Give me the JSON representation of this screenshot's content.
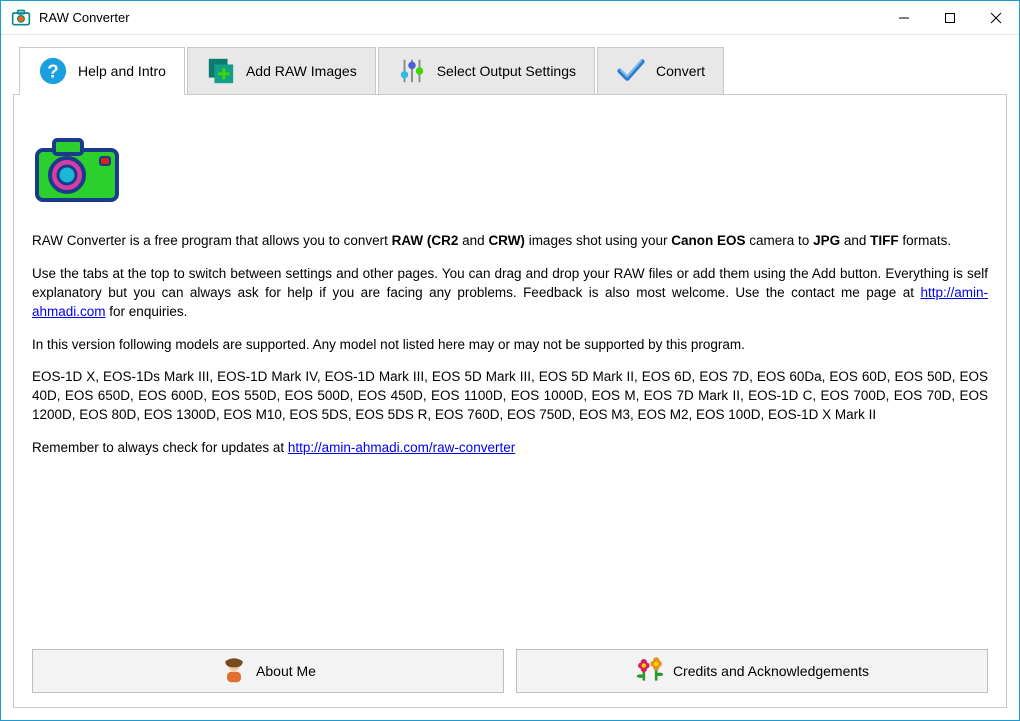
{
  "window": {
    "title": "RAW Converter"
  },
  "tabs": [
    {
      "label": "Help and Intro"
    },
    {
      "label": "Add RAW Images"
    },
    {
      "label": "Select Output Settings"
    },
    {
      "label": "Convert"
    }
  ],
  "intro": {
    "p1_pre": "RAW Converter is a free program that allows you to convert ",
    "p1_b1": "RAW (CR2",
    "p1_mid1": " and ",
    "p1_b2": "CRW)",
    "p1_mid2": " images shot using your ",
    "p1_b3": "Canon EOS",
    "p1_mid3": " camera to ",
    "p1_b4": "JPG",
    "p1_mid4": " and ",
    "p1_b5": "TIFF",
    "p1_post": " formats.",
    "p2_pre": "Use the tabs at the top to switch between settings and other pages. You can drag and drop your RAW files or add them using the Add button. Everything is self explanatory but you can always ask for help if you are facing any problems. Feedback is also most welcome. Use the contact me page at ",
    "p2_link": "http://amin-ahmadi.com",
    "p2_post": " for enquiries.",
    "p3": "In this version following models are supported. Any model not listed here may or may not be supported by this program.",
    "p4": "EOS-1D X, EOS-1Ds Mark III, EOS-1D Mark IV, EOS-1D Mark III, EOS 5D Mark III, EOS 5D Mark II, EOS 6D, EOS 7D, EOS 60Da, EOS 60D, EOS 50D, EOS 40D, EOS 650D, EOS 600D, EOS 550D, EOS 500D, EOS 450D, EOS 1100D, EOS 1000D, EOS M, EOS 7D Mark II, EOS-1D C, EOS 700D, EOS 70D, EOS 1200D, EOS 80D, EOS 1300D, EOS M10, EOS 5DS, EOS 5DS R, EOS 760D, EOS 750D, EOS M3, EOS M2, EOS 100D, EOS-1D X Mark II",
    "p5_pre": "Remember to always check for updates at ",
    "p5_link": "http://amin-ahmadi.com/raw-converter"
  },
  "buttons": {
    "about": "About Me",
    "credits": "Credits and Acknowledgements"
  }
}
